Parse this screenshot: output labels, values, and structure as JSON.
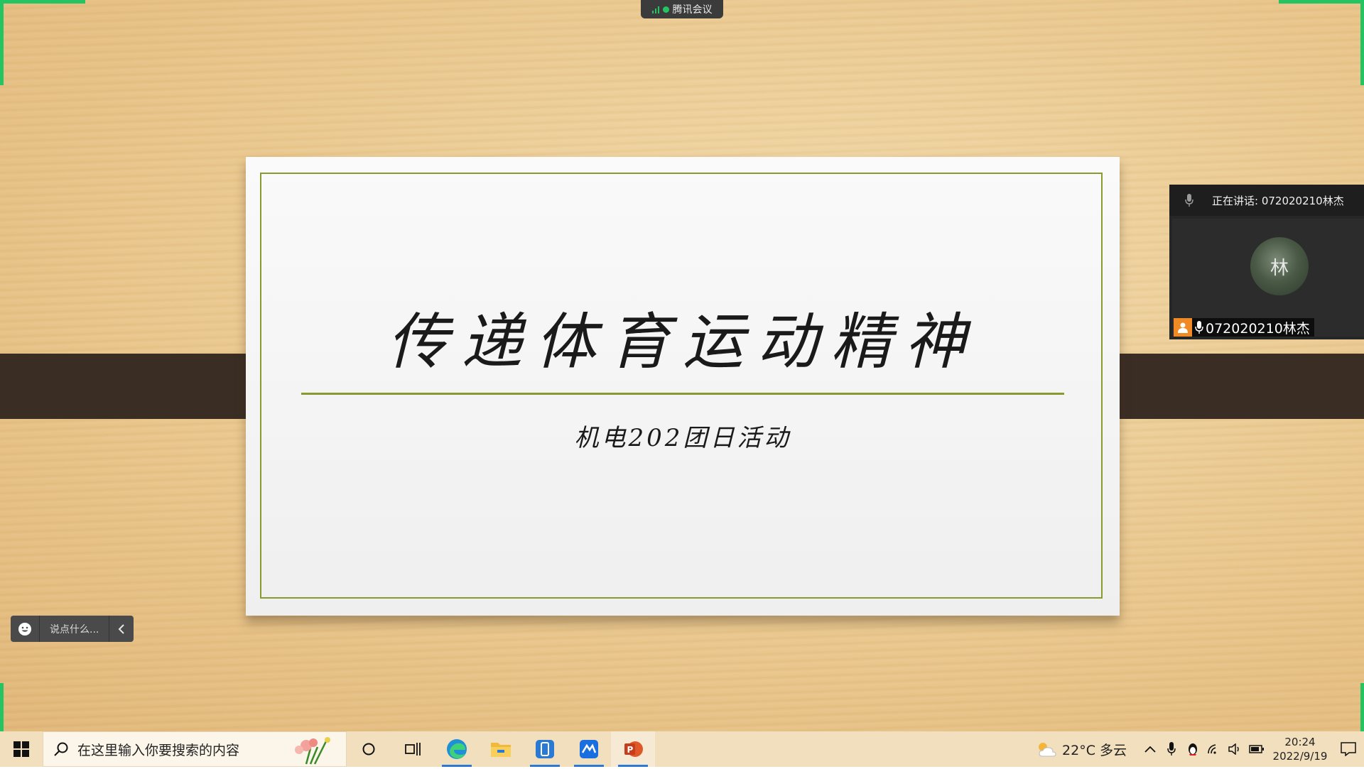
{
  "meeting": {
    "app_name": "腾讯会议"
  },
  "slide": {
    "title": "传递体育运动精神",
    "subtitle": "机电202团日活动"
  },
  "speaker": {
    "speaking_label": "正在讲话: 072020210林杰",
    "name": "072020210林杰",
    "avatar_text": "林"
  },
  "chat": {
    "placeholder": "说点什么..."
  },
  "taskbar": {
    "search_placeholder": "在这里输入你要搜索的内容",
    "weather": "22°C  多云",
    "time": "20:24",
    "date": "2022/9/19"
  },
  "colors": {
    "accent_green": "#25c463",
    "slide_frame": "#8a9a2e",
    "band": "#3a2e24",
    "taskbar_active": "#2a7ad4"
  }
}
